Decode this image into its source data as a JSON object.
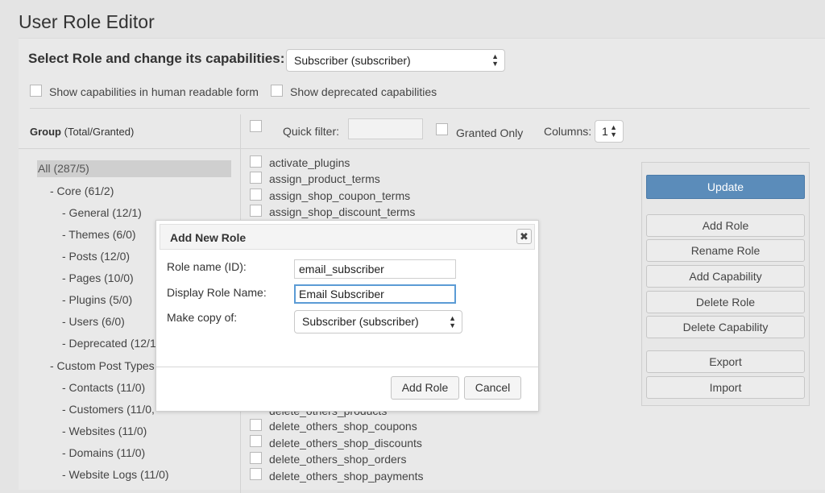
{
  "page": {
    "title": "User Role Editor"
  },
  "role_selector": {
    "label": "Select Role and change its capabilities:",
    "selected": "Subscriber (subscriber)"
  },
  "options": {
    "human_readable": "Show capabilities in human readable form",
    "deprecated": "Show deprecated capabilities"
  },
  "group_header": {
    "bold": "Group",
    "rest": " (Total/Granted)"
  },
  "filter_bar": {
    "quick_filter_label": "Quick filter:",
    "granted_only_label": "Granted Only",
    "columns_label": "Columns:",
    "columns_value": "1"
  },
  "groups": [
    "All (287/5)",
    "- Core (61/2)",
    "- General (12/1)",
    "- Themes (6/0)",
    "- Posts (12/0)",
    "- Pages (10/0)",
    "- Plugins (5/0)",
    "- Users (6/0)",
    "- Deprecated (12/1",
    "- Custom Post Types",
    "- Contacts (11/0)",
    "- Customers (11/0,",
    "- Websites (11/0)",
    "- Domains (11/0)",
    "- Website Logs (11/0)"
  ],
  "capabilities_top": [
    "activate_plugins",
    "assign_product_terms",
    "assign_shop_coupon_terms",
    "assign_shop_discount_terms"
  ],
  "capabilities_bottom": [
    "delete_others_products",
    "delete_others_shop_coupons",
    "delete_others_shop_discounts",
    "delete_others_shop_orders",
    "delete_others_shop_payments"
  ],
  "actions": {
    "update": "Update",
    "add_role": "Add Role",
    "rename_role": "Rename Role",
    "add_capability": "Add Capability",
    "delete_role": "Delete Role",
    "delete_capability": "Delete Capability",
    "export": "Export",
    "import": "Import"
  },
  "dialog": {
    "title": "Add New Role",
    "close_glyph": "✖",
    "role_name_label": "Role name (ID):",
    "role_name_value": "email_subscriber",
    "display_name_label": "Display Role Name:",
    "display_name_value": "Email Subscriber",
    "copy_label": "Make copy of:",
    "copy_value": "Subscriber (subscriber)",
    "add_button": "Add Role",
    "cancel_button": "Cancel"
  },
  "icons": {
    "select_arrows": "▲▼"
  },
  "colors": {
    "primary_button": "#5b8cba",
    "focus_border": "#5b9bd5"
  }
}
